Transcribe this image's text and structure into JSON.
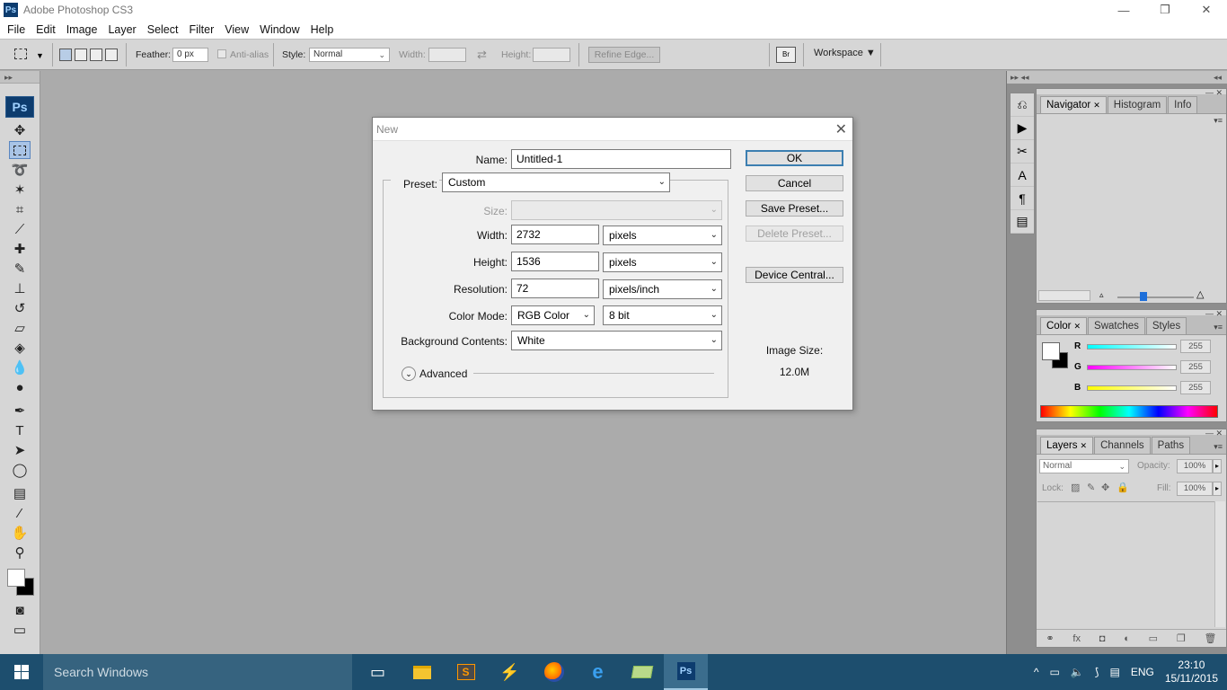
{
  "window": {
    "app_icon": "Ps",
    "title": "Adobe Photoshop CS3",
    "min_icon": "—",
    "restore_icon": "❐",
    "close_icon": "✕"
  },
  "menu": [
    "File",
    "Edit",
    "Image",
    "Layer",
    "Select",
    "Filter",
    "View",
    "Window",
    "Help"
  ],
  "options_bar": {
    "feather_label": "Feather:",
    "feather_value": "0 px",
    "antialias_label": "Anti-alias",
    "style_label": "Style:",
    "style_value": "Normal",
    "width_label": "Width:",
    "height_label": "Height:",
    "refine_edge": "Refine Edge...",
    "workspace": "Workspace ▼"
  },
  "toolbox": {
    "logo": "Ps"
  },
  "dialog": {
    "title": "New",
    "close_icon": "✕",
    "name_label": "Name:",
    "name_value": "Untitled-1",
    "preset_label": "Preset:",
    "preset_value": "Custom",
    "size_label": "Size:",
    "width_label": "Width:",
    "width_value": "2732",
    "width_unit": "pixels",
    "height_label": "Height:",
    "height_value": "1536",
    "height_unit": "pixels",
    "resolution_label": "Resolution:",
    "resolution_value": "72",
    "resolution_unit": "pixels/inch",
    "color_mode_label": "Color Mode:",
    "color_mode_value": "RGB Color",
    "bit_depth": "8 bit",
    "bg_contents_label": "Background Contents:",
    "bg_contents_value": "White",
    "advanced_label": "Advanced",
    "ok": "OK",
    "cancel": "Cancel",
    "save_preset": "Save Preset...",
    "delete_preset": "Delete Preset...",
    "device_central": "Device Central...",
    "image_size_label": "Image Size:",
    "image_size_value": "12.0M"
  },
  "panels": {
    "navigator_tabs": [
      "Navigator",
      "Histogram",
      "Info"
    ],
    "color_tabs": [
      "Color",
      "Swatches",
      "Styles"
    ],
    "color_channels": [
      {
        "label": "R",
        "value": "255",
        "gradient": "linear-gradient(to right,#00ffff,#ffffff)"
      },
      {
        "label": "G",
        "value": "255",
        "gradient": "linear-gradient(to right,#ff00ff,#ffffff)"
      },
      {
        "label": "B",
        "value": "255",
        "gradient": "linear-gradient(to right,#ffff00,#ffffff)"
      }
    ],
    "layers_tabs": [
      "Layers",
      "Channels",
      "Paths"
    ],
    "blend_mode": "Normal",
    "opacity_label": "Opacity:",
    "opacity_value": "100%",
    "lock_label": "Lock:",
    "fill_label": "Fill:",
    "fill_value": "100%"
  },
  "taskbar": {
    "search_placeholder": "Search Windows",
    "language": "ENG",
    "time": "23:10",
    "date": "15/11/2015"
  },
  "colors": {
    "taskbar": "#1d4e6e",
    "workspace": "#ababab",
    "panel": "#d6d6d6",
    "ps_blue": "#0d3c6e"
  }
}
